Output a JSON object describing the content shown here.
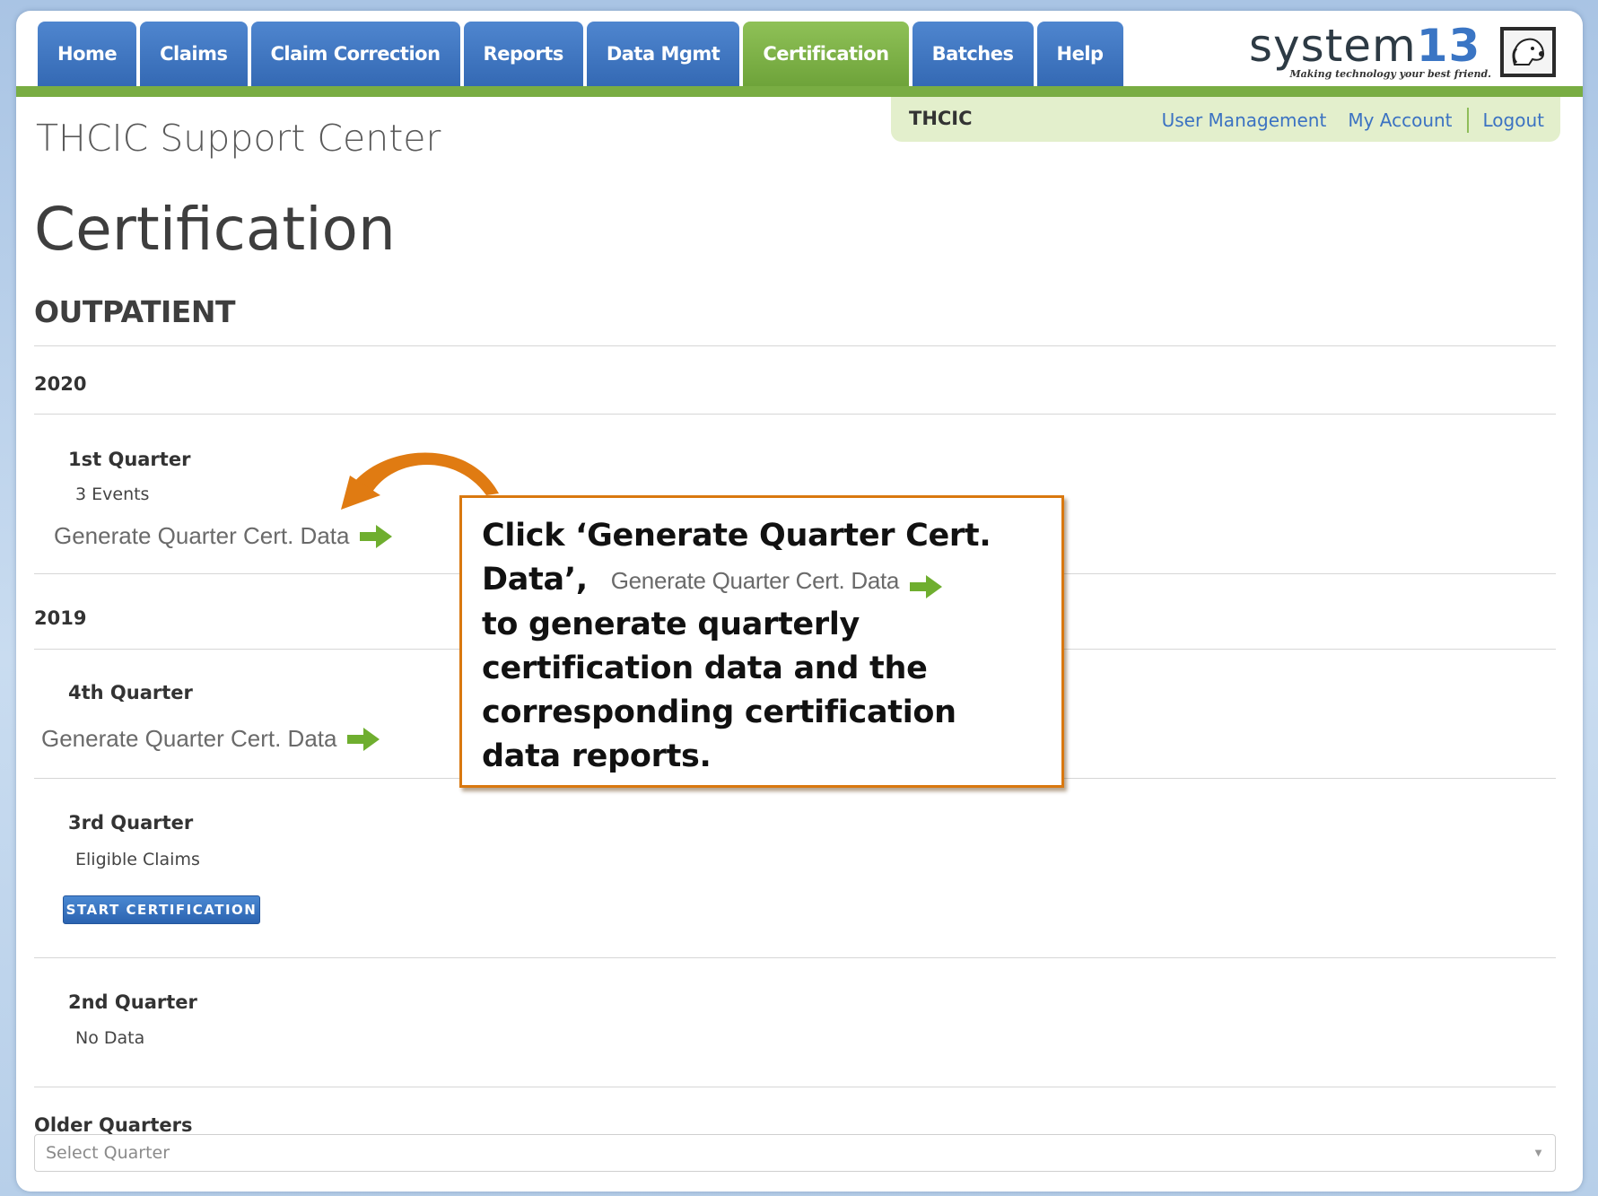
{
  "nav": {
    "tabs": [
      {
        "label": "Home"
      },
      {
        "label": "Claims"
      },
      {
        "label": "Claim Correction"
      },
      {
        "label": "Reports"
      },
      {
        "label": "Data Mgmt"
      },
      {
        "label": "Certification",
        "active": true
      },
      {
        "label": "Batches"
      },
      {
        "label": "Help"
      }
    ]
  },
  "logo": {
    "word": "system",
    "number": "13",
    "tagline": "Making technology your best friend.",
    "icon": "dog-logo-icon"
  },
  "userbar": {
    "org": "THCIC",
    "user_management": "User Management",
    "my_account": "My Account",
    "logout": "Logout"
  },
  "site_title": "THCIC Support Center",
  "page_title": "Certification",
  "section_title": "OUTPATIENT",
  "years": [
    {
      "year": "2020",
      "quarters": [
        {
          "name": "1st Quarter",
          "sub": "3 Events",
          "action": "Generate Quarter Cert. Data"
        }
      ]
    },
    {
      "year": "2019",
      "quarters": [
        {
          "name": "4th Quarter",
          "action": "Generate Quarter Cert. Data"
        },
        {
          "name": "3rd Quarter",
          "sub": "Eligible Claims",
          "button": "START CERTIFICATION"
        },
        {
          "name": "2nd Quarter",
          "sub": "No Data"
        }
      ]
    }
  ],
  "older": {
    "label": "Older Quarters",
    "placeholder": "Select Quarter"
  },
  "callout": {
    "line1": "Click ‘Generate Quarter Cert.",
    "line2": "Data’,",
    "inline_action": "Generate Quarter Cert. Data",
    "rest": "to generate quarterly certification data and the corresponding certification data reports."
  },
  "colors": {
    "nav_blue": "#3469b4",
    "nav_green": "#79ad43",
    "callout_border": "#d9780f",
    "arrow_green": "#6fae2f"
  }
}
